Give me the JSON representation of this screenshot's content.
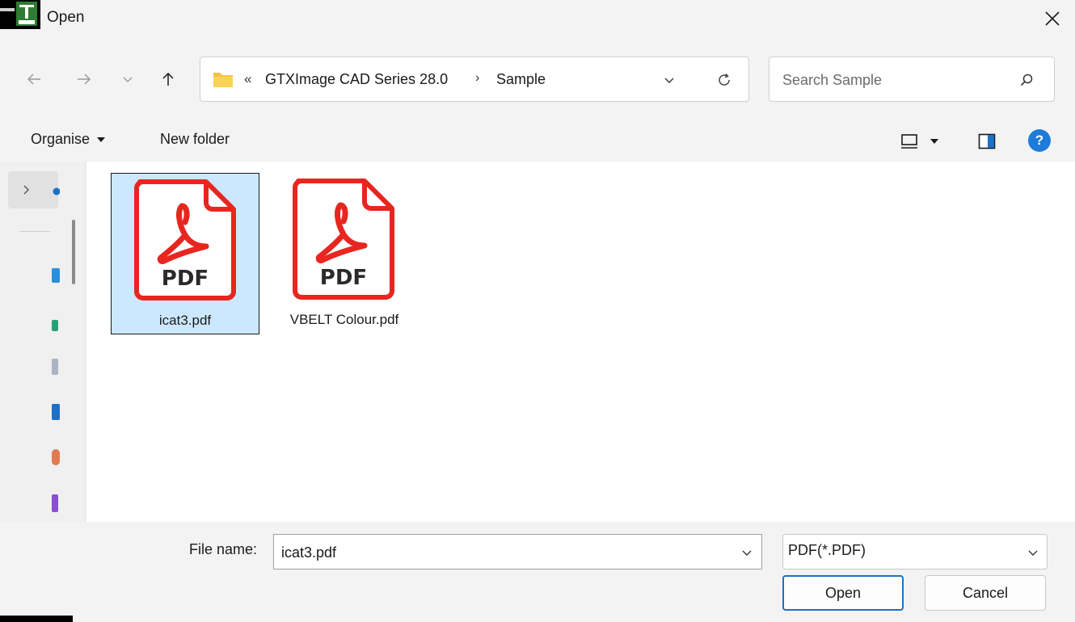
{
  "window": {
    "title": "Open",
    "app_icon": "cad-app-icon",
    "close_icon": "close-icon"
  },
  "nav": {
    "back_icon": "arrow-left-icon",
    "forward_icon": "arrow-right-icon",
    "recent_icon": "chevron-down-icon",
    "up_icon": "arrow-up-icon"
  },
  "address": {
    "overflow": "«",
    "crumbs": [
      "GTXImage CAD Series 28.0",
      "Sample"
    ],
    "separator": "›"
  },
  "search": {
    "placeholder": "Search Sample",
    "value": ""
  },
  "toolbar": {
    "organise_label": "Organise",
    "new_folder_label": "New folder",
    "help_label": "?"
  },
  "files": [
    {
      "name": "icat3.pdf",
      "type_label": "PDF",
      "selected": true
    },
    {
      "name": "VBELT Colour.pdf",
      "type_label": "PDF",
      "selected": false
    }
  ],
  "footer": {
    "filename_label": "File name:",
    "filename_value": "icat3.pdf",
    "filetype_value": "PDF(*.PDF)",
    "open_label": "Open",
    "cancel_label": "Cancel"
  },
  "colors": {
    "accent": "#1f6fc5",
    "selection": "#cce8ff",
    "pdf_red": "#e8261f",
    "folder_yellow": "#f6c142"
  }
}
